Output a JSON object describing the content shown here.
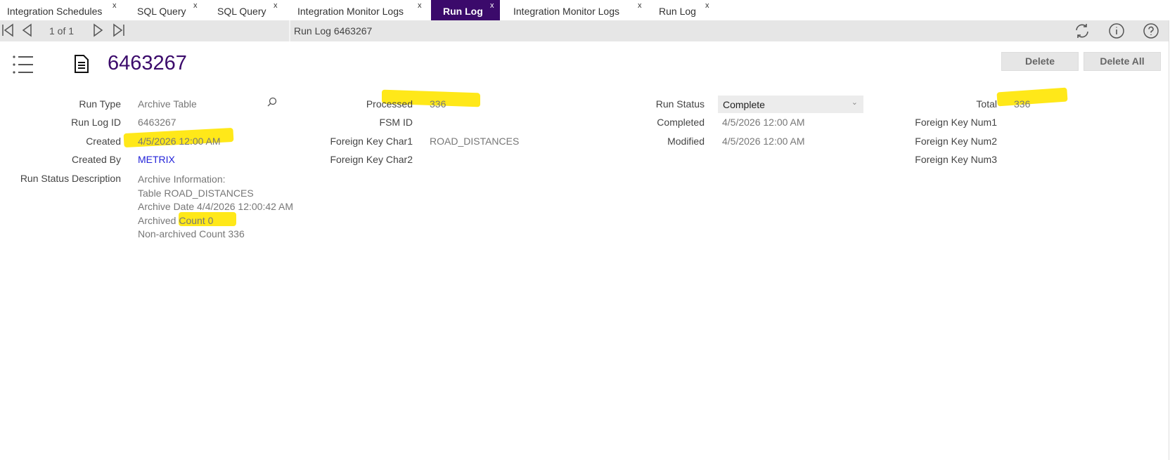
{
  "tabs": [
    {
      "label": "Integration Schedules",
      "close": "x"
    },
    {
      "label": "SQL Query",
      "close": "x"
    },
    {
      "label": "SQL Query",
      "close": "x"
    },
    {
      "label": "Integration Monitor Logs",
      "close": "x"
    },
    {
      "label": "Run Log",
      "close": "x",
      "active": true
    },
    {
      "label": "Integration Monitor Logs",
      "close": "x"
    },
    {
      "label": "Run Log",
      "close": "x"
    }
  ],
  "toolbar": {
    "pager": "1 of 1",
    "breadcrumb": "Run Log 6463267"
  },
  "header": {
    "title": "6463267",
    "delete_label": "Delete",
    "delete_all_label": "Delete All"
  },
  "fields": {
    "run_type": {
      "label": "Run Type",
      "value": "Archive Table"
    },
    "run_log_id": {
      "label": "Run Log ID",
      "value": "6463267"
    },
    "created": {
      "label": "Created",
      "value": "4/5/2026 12:00 AM"
    },
    "created_by": {
      "label": "Created By",
      "value": "METRIX"
    },
    "run_status_description": {
      "label": "Run Status Description",
      "lines": [
        "Archive Information:",
        "Table ROAD_DISTANCES",
        "Archive Date 4/4/2026 12:00:42 AM",
        "Archived Count 0",
        "Non-archived Count 336"
      ]
    },
    "processed": {
      "label": "Processed",
      "value": "336"
    },
    "fsm_id": {
      "label": "FSM ID",
      "value": ""
    },
    "foreign_key_char1": {
      "label": "Foreign Key Char1",
      "value": "ROAD_DISTANCES"
    },
    "foreign_key_char2": {
      "label": "Foreign Key Char2",
      "value": ""
    },
    "run_status": {
      "label": "Run Status",
      "value": "Complete"
    },
    "completed": {
      "label": "Completed",
      "value": "4/5/2026 12:00 AM"
    },
    "modified": {
      "label": "Modified",
      "value": "4/5/2026 12:00 AM"
    },
    "total": {
      "label": "Total",
      "value": "336"
    },
    "foreign_key_num1": {
      "label": "Foreign Key Num1",
      "value": ""
    },
    "foreign_key_num2": {
      "label": "Foreign Key Num2",
      "value": ""
    },
    "foreign_key_num3": {
      "label": "Foreign Key Num3",
      "value": ""
    }
  },
  "colors": {
    "accent": "#3b0a6b",
    "link": "#2323d9",
    "highlight": "#ffe600"
  }
}
